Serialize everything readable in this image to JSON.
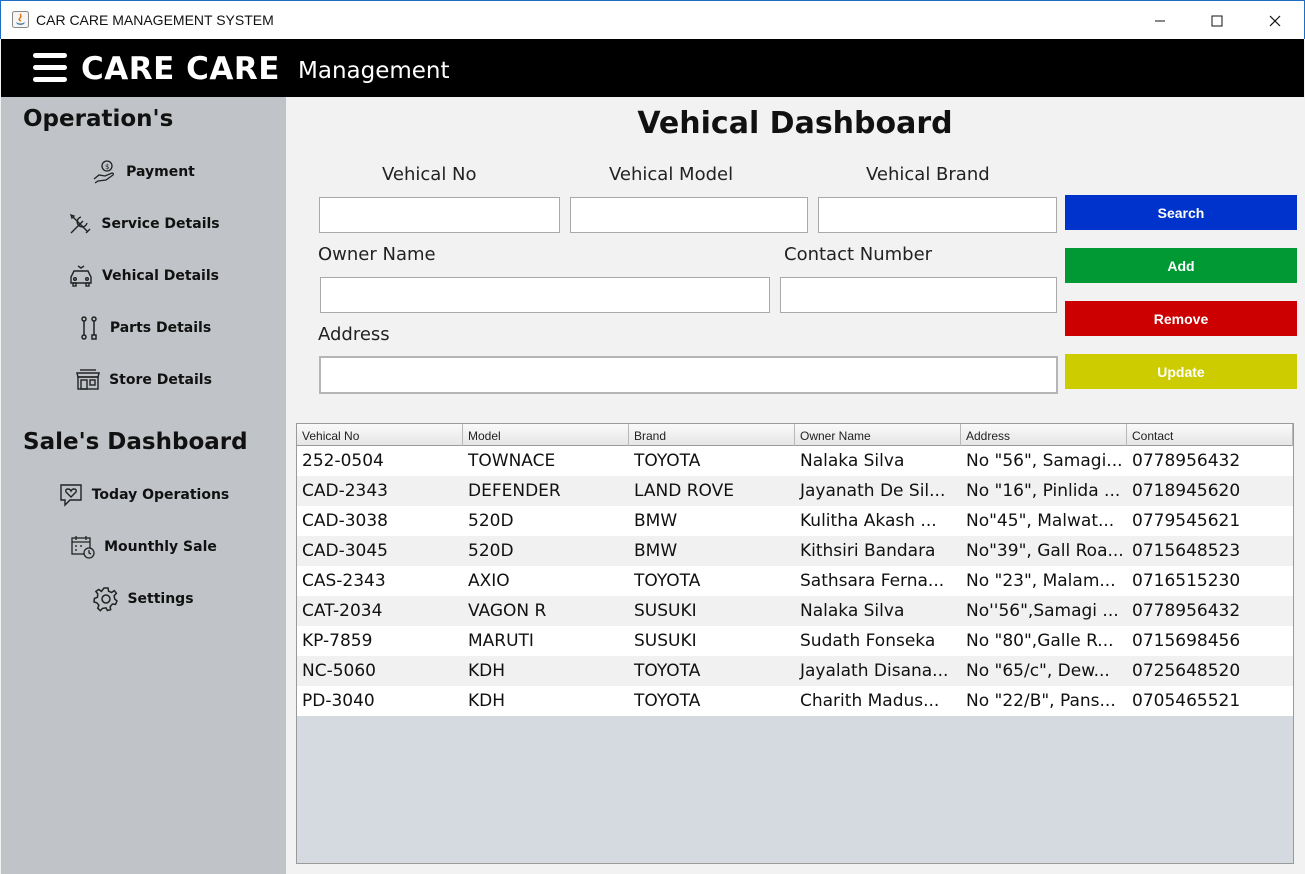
{
  "window": {
    "title": "CAR CARE MANAGEMENT SYSTEM"
  },
  "header": {
    "brand": "CARE CARE",
    "subtitle": "Management"
  },
  "sidebar": {
    "operations_title": "Operation's",
    "operations": [
      {
        "label": "Payment",
        "icon": "payment-hand-icon"
      },
      {
        "label": "Service Details",
        "icon": "wrench-screwdriver-icon"
      },
      {
        "label": "Vehical Details",
        "icon": "car-icon"
      },
      {
        "label": "Parts Details",
        "icon": "parts-tools-icon"
      },
      {
        "label": "Store Details",
        "icon": "store-icon"
      }
    ],
    "sales_title": "Sale's Dashboard",
    "sales": [
      {
        "label": "Today Operations",
        "icon": "heart-chat-icon"
      },
      {
        "label": "Mounthly Sale",
        "icon": "calendar-clock-icon"
      },
      {
        "label": "Settings",
        "icon": "gear-icon"
      }
    ]
  },
  "main": {
    "title": "Vehical Dashboard",
    "fields": {
      "vehical_no": {
        "label": "Vehical No",
        "value": ""
      },
      "vehical_model": {
        "label": "Vehical Model",
        "value": ""
      },
      "vehical_brand": {
        "label": "Vehical Brand",
        "value": ""
      },
      "owner_name": {
        "label": "Owner Name",
        "value": ""
      },
      "contact_number": {
        "label": "Contact Number",
        "value": ""
      },
      "address": {
        "label": "Address",
        "value": ""
      }
    },
    "buttons": {
      "search": {
        "label": "Search",
        "color": "#0033cc"
      },
      "add": {
        "label": "Add",
        "color": "#009933"
      },
      "remove": {
        "label": "Remove",
        "color": "#cc0000"
      },
      "update": {
        "label": "Update",
        "color": "#cccc00"
      }
    }
  },
  "table": {
    "columns": [
      "Vehical No",
      "Model",
      "Brand",
      "Owner Name",
      "Address",
      "Contact"
    ],
    "rows": [
      [
        "252-0504",
        "TOWNACE",
        "TOYOTA",
        "Nalaka Silva",
        "No \"56\", Samagi...",
        "0778956432"
      ],
      [
        "CAD-2343",
        "DEFENDER",
        "LAND ROVE",
        "Jayanath De Sil...",
        "No \"16\", Pinlida ...",
        "0718945620"
      ],
      [
        "CAD-3038",
        "520D",
        "BMW",
        "Kulitha Akash ...",
        "No\"45\", Malwat...",
        "0779545621"
      ],
      [
        "CAD-3045",
        "520D",
        "BMW",
        "Kithsiri Bandara",
        "No\"39\", Gall Roa...",
        "0715648523"
      ],
      [
        "CAS-2343",
        "AXIO",
        "TOYOTA",
        "Sathsara Ferna...",
        "No \"23\", Malam...",
        "0716515230"
      ],
      [
        "CAT-2034",
        "VAGON R",
        "SUSUKI",
        "Nalaka Silva",
        "No''56\",Samagi ...",
        "0778956432"
      ],
      [
        "KP-7859",
        "MARUTI",
        "SUSUKI",
        "Sudath Fonseka",
        "No \"80\",Galle R...",
        "0715698456"
      ],
      [
        "NC-5060",
        "KDH",
        "TOYOTA",
        "Jayalath Disana...",
        "No \"65/c\",  Dew...",
        "0725648520"
      ],
      [
        "PD-3040",
        "KDH",
        "TOYOTA",
        "Charith Madus...",
        "No \"22/B\", Pans...",
        "0705465521"
      ]
    ]
  }
}
